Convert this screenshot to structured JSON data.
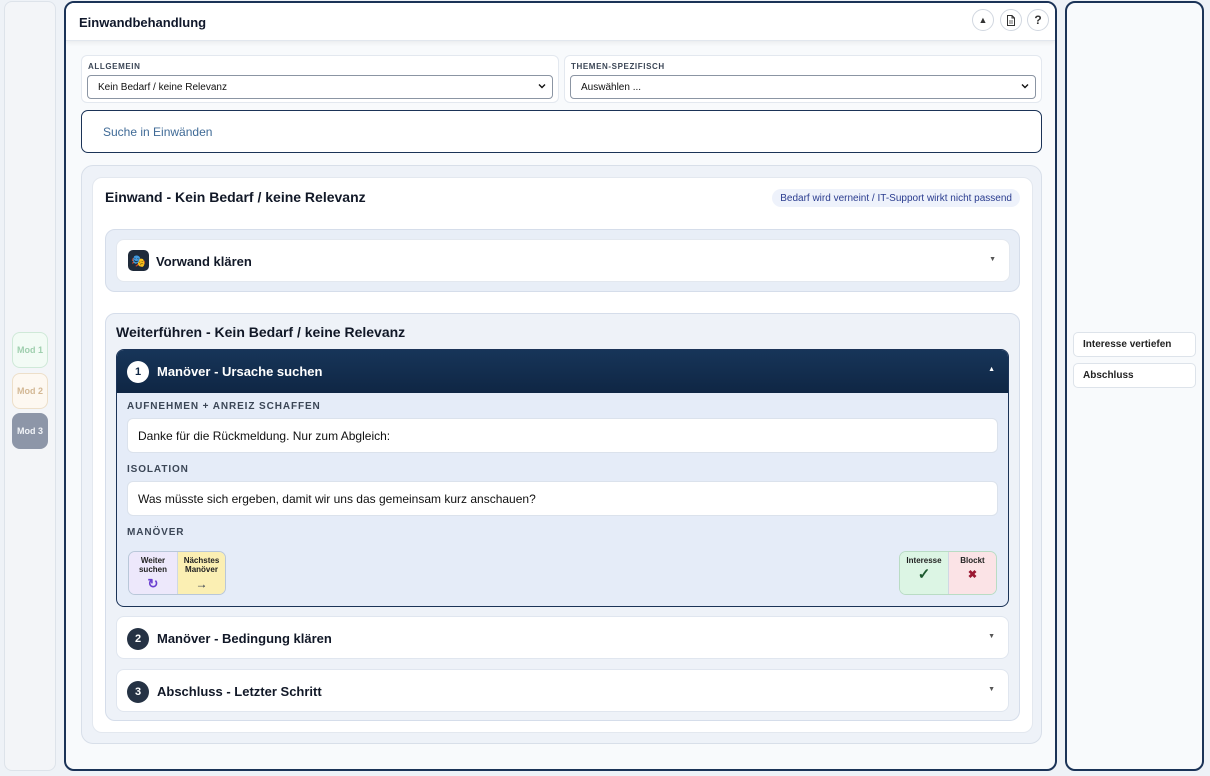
{
  "left_rail": {
    "mods": [
      {
        "label": "Mod 1"
      },
      {
        "label": "Mod 2"
      },
      {
        "label": "Mod 3"
      }
    ]
  },
  "header": {
    "title": "Einwandbehandlung",
    "help_label": "?"
  },
  "filters": {
    "general": {
      "label": "ALLGEMEIN",
      "value": "Kein Bedarf / keine Relevanz"
    },
    "topic": {
      "label": "THEMEN-SPEZIFISCH",
      "value": "Auswählen ..."
    }
  },
  "search": {
    "placeholder": "Suche in Einwänden"
  },
  "objection": {
    "title": "Einwand - Kein Bedarf / keine Relevanz",
    "badge": "Bedarf wird verneint / IT-Support wirkt nicht passend",
    "pretext": {
      "label": "Vorwand klären"
    },
    "continue_title": "Weiterführen - Kein Bedarf / keine Relevanz",
    "steps": [
      {
        "number": "1",
        "title": "Manöver - Ursache suchen",
        "fields": [
          {
            "label": "AUFNEHMEN + ANREIZ SCHAFFEN",
            "text": "Danke für die Rückmeldung. Nur zum Abgleich:"
          },
          {
            "label": "ISOLATION",
            "text": "Was müsste sich ergeben, damit wir uns das gemeinsam kurz anschauen?"
          }
        ],
        "maneuver_label": "MANÖVER",
        "actions_left": [
          {
            "line1": "Weiter",
            "line2": "suchen",
            "symbol": "↻"
          },
          {
            "line1": "Nächstes",
            "line2": "Manöver",
            "symbol": "→"
          }
        ],
        "actions_right": [
          {
            "line1": "Interesse",
            "symbol": "✓"
          },
          {
            "line1": "Blockt",
            "symbol": "✖"
          }
        ]
      },
      {
        "number": "2",
        "title": "Manöver - Bedingung klären"
      },
      {
        "number": "3",
        "title": "Abschluss - Letzter Schritt"
      }
    ]
  },
  "right_panel": {
    "items": [
      {
        "label": "Interesse vertiefen"
      },
      {
        "label": "Abschluss"
      }
    ]
  },
  "colors": {
    "navy": "#173559",
    "interest_green": "#dcf5e4",
    "block_red": "#fbe3e6",
    "next_yellow": "#fbefb3",
    "continue_purple": "#ede8fb"
  }
}
